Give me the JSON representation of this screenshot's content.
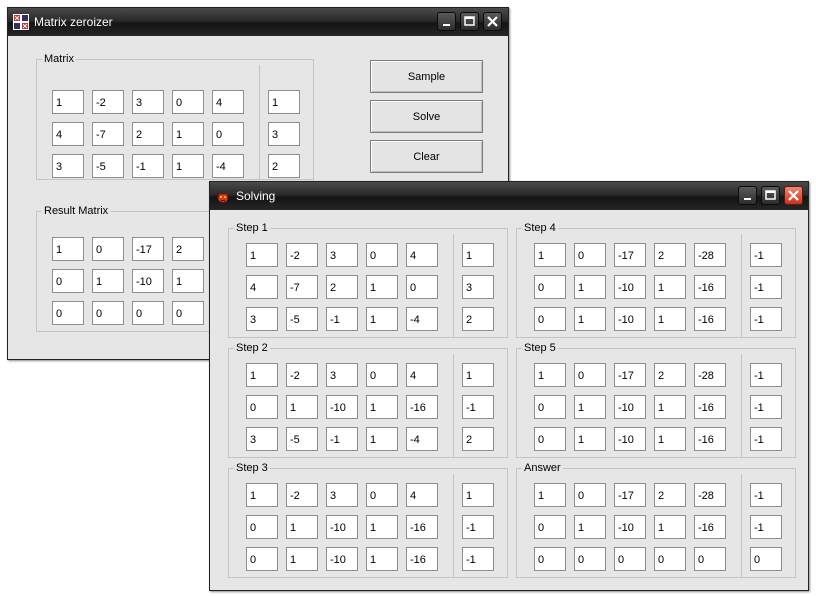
{
  "main_window": {
    "title": "Matrix zeroizer",
    "matrix_group": {
      "label": "Matrix",
      "rows": [
        [
          "1",
          "-2",
          "3",
          "0",
          "4"
        ],
        [
          "4",
          "-7",
          "2",
          "1",
          "0"
        ],
        [
          "3",
          "-5",
          "-1",
          "1",
          "-4"
        ]
      ],
      "constants": [
        "1",
        "3",
        "2"
      ]
    },
    "result_group": {
      "label": "Result Matrix",
      "rows": [
        [
          "1",
          "0",
          "-17",
          "2"
        ],
        [
          "0",
          "1",
          "-10",
          "1"
        ],
        [
          "0",
          "0",
          "0",
          "0"
        ]
      ]
    },
    "buttons": {
      "sample": "Sample",
      "solve": "Solve",
      "clear": "Clear"
    }
  },
  "solving_window": {
    "title": "Solving",
    "steps": [
      {
        "label": "Step 1",
        "rows": [
          [
            "1",
            "-2",
            "3",
            "0",
            "4"
          ],
          [
            "4",
            "-7",
            "2",
            "1",
            "0"
          ],
          [
            "3",
            "-5",
            "-1",
            "1",
            "-4"
          ]
        ],
        "constants": [
          "1",
          "3",
          "2"
        ]
      },
      {
        "label": "Step 2",
        "rows": [
          [
            "1",
            "-2",
            "3",
            "0",
            "4"
          ],
          [
            "0",
            "1",
            "-10",
            "1",
            "-16"
          ],
          [
            "3",
            "-5",
            "-1",
            "1",
            "-4"
          ]
        ],
        "constants": [
          "1",
          "-1",
          "2"
        ]
      },
      {
        "label": "Step 3",
        "rows": [
          [
            "1",
            "-2",
            "3",
            "0",
            "4"
          ],
          [
            "0",
            "1",
            "-10",
            "1",
            "-16"
          ],
          [
            "0",
            "1",
            "-10",
            "1",
            "-16"
          ]
        ],
        "constants": [
          "1",
          "-1",
          "-1"
        ]
      },
      {
        "label": "Step 4",
        "rows": [
          [
            "1",
            "0",
            "-17",
            "2",
            "-28"
          ],
          [
            "0",
            "1",
            "-10",
            "1",
            "-16"
          ],
          [
            "0",
            "1",
            "-10",
            "1",
            "-16"
          ]
        ],
        "constants": [
          "-1",
          "-1",
          "-1"
        ]
      },
      {
        "label": "Step 5",
        "rows": [
          [
            "1",
            "0",
            "-17",
            "2",
            "-28"
          ],
          [
            "0",
            "1",
            "-10",
            "1",
            "-16"
          ],
          [
            "0",
            "1",
            "-10",
            "1",
            "-16"
          ]
        ],
        "constants": [
          "-1",
          "-1",
          "-1"
        ]
      },
      {
        "label": "Answer",
        "rows": [
          [
            "1",
            "0",
            "-17",
            "2",
            "-28"
          ],
          [
            "0",
            "1",
            "-10",
            "1",
            "-16"
          ],
          [
            "0",
            "0",
            "0",
            "0",
            "0"
          ]
        ],
        "constants": [
          "-1",
          "-1",
          "0"
        ]
      }
    ]
  }
}
